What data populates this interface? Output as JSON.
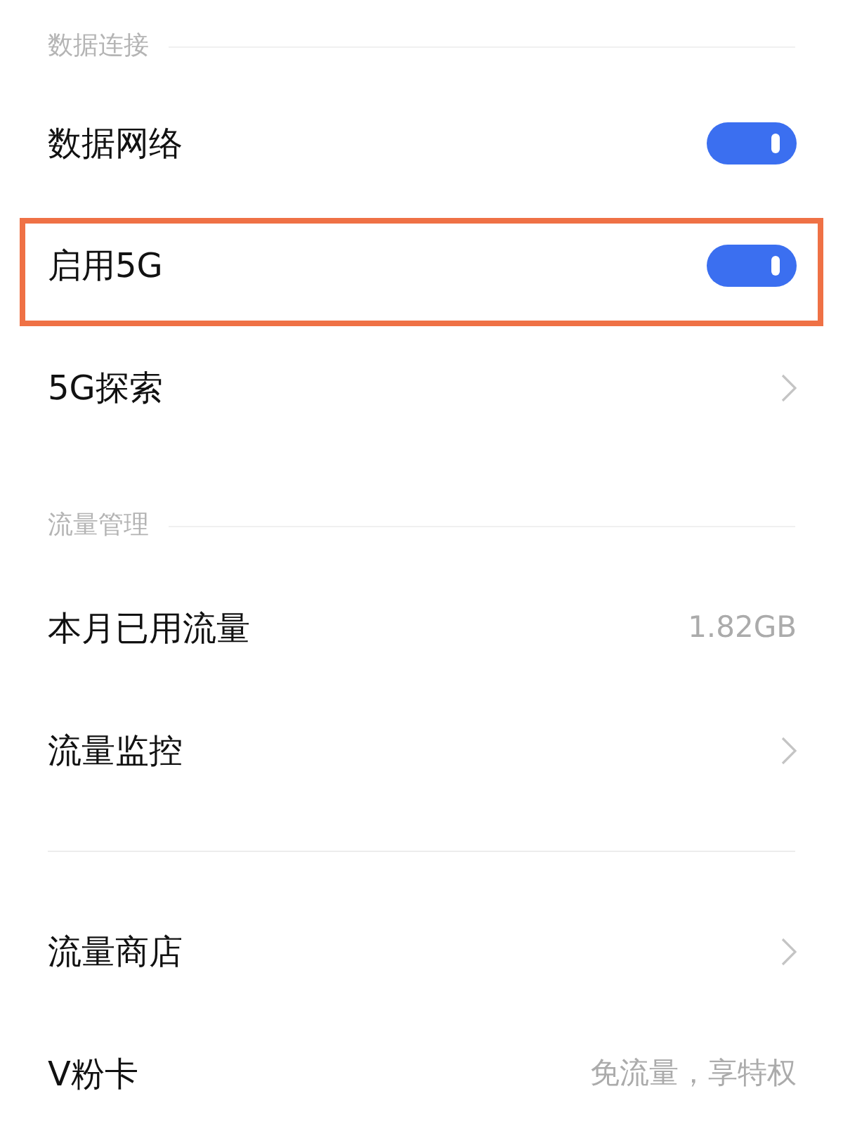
{
  "sections": [
    {
      "header": "数据连接",
      "items": [
        {
          "kind": "toggle",
          "label": "数据网络",
          "on": true,
          "highlighted": false
        },
        {
          "kind": "toggle",
          "label": "启用5G",
          "on": true,
          "highlighted": true
        },
        {
          "kind": "link",
          "label": "5G探索",
          "highlighted": false
        }
      ]
    },
    {
      "header": "流量管理",
      "items": [
        {
          "kind": "value",
          "label": "本月已用流量",
          "value": "1.82GB",
          "highlighted": false
        },
        {
          "kind": "link",
          "label": "流量监控",
          "highlighted": false
        }
      ]
    },
    {
      "items": [
        {
          "kind": "link",
          "label": "流量商店",
          "highlighted": false
        },
        {
          "kind": "value",
          "label": "V粉卡",
          "value": "免流量，享特权",
          "highlighted": false
        }
      ]
    }
  ]
}
